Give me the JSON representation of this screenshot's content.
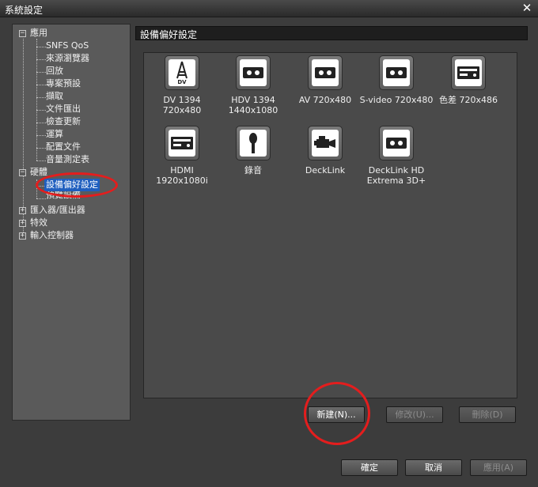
{
  "window": {
    "title": "系統設定",
    "close_glyph": "✕"
  },
  "tree": {
    "app_group": "應用",
    "app_items": [
      "SNFS QoS",
      "來源瀏覽器",
      "回放",
      "專案預設",
      "擷取",
      "文件匯出",
      "檢查更新",
      "運算",
      "配置文件",
      "音量測定表"
    ],
    "hardware_group": "硬體",
    "hardware_items": [
      "設備偏好設定",
      "預覽設備"
    ],
    "io_group": "匯入器/匯出器",
    "effects_group": "特效",
    "input_group": "輸入控制器",
    "expand_glyph": "+",
    "collapse_glyph": "−"
  },
  "panel": {
    "title": "設備偏好設定"
  },
  "devices": [
    {
      "name": "DV 1394 720x480",
      "icon": "dv-icon"
    },
    {
      "name": "HDV 1394 1440x1080",
      "line1": "HDV 1394",
      "line2": "1440x1080",
      "icon": "tape-icon"
    },
    {
      "name": "AV 720x480",
      "icon": "tape-icon"
    },
    {
      "name": "S-video 720x480",
      "icon": "tape-icon"
    },
    {
      "name": "色差 720x486",
      "icon": "deck-icon"
    },
    {
      "name": "HDMI 1920x1080i",
      "icon": "deck-icon"
    },
    {
      "name": "錄音",
      "icon": "microphone-icon"
    },
    {
      "name": "DeckLink",
      "icon": "camera-icon"
    },
    {
      "name": "DeckLink HD Extrema 3D+",
      "line1": "DeckLink HD",
      "line2": "Extrema 3D+",
      "icon": "tape-icon"
    }
  ],
  "buttons": {
    "new": "新建(N)...",
    "modify": "修改(U)...",
    "delete": "刪除(D)",
    "ok": "確定",
    "cancel": "取消",
    "apply": "應用(A)"
  },
  "colors": {
    "annotation": "#e41d1d",
    "selection": "#1f5fbf"
  }
}
